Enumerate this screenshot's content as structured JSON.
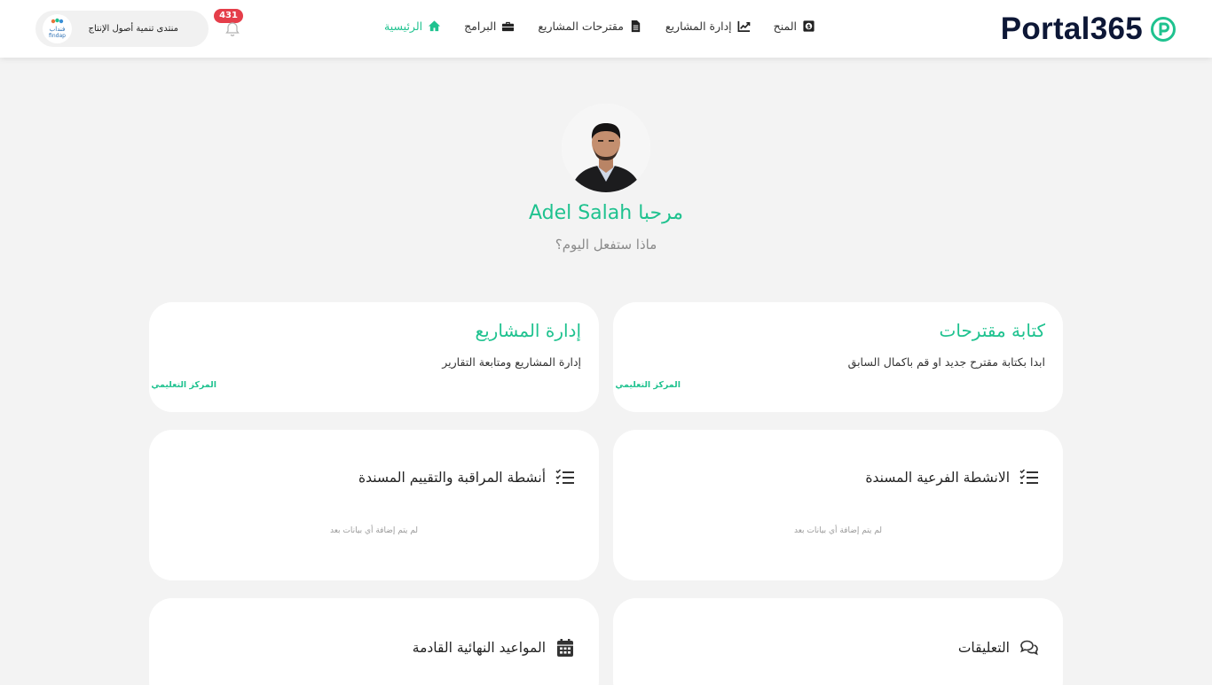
{
  "header": {
    "logo_text": "Portal365",
    "notifications_count": "431",
    "org_name": "منتدى تنمية أصول الإنتاج",
    "org_logo_text_ar": "فنداب",
    "org_logo_text_en": "findap"
  },
  "nav": [
    {
      "label": "الرئيسية",
      "icon": "home-icon",
      "active": true
    },
    {
      "label": "البرامج",
      "icon": "briefcase-icon",
      "active": false
    },
    {
      "label": "مقترحات المشاريع",
      "icon": "file-icon",
      "active": false
    },
    {
      "label": "إدارة المشاريع",
      "icon": "chart-line-icon",
      "active": false
    },
    {
      "label": "المنح",
      "icon": "money-bag-icon",
      "active": false
    }
  ],
  "profile": {
    "welcome": "مرحبا Adel Salah",
    "question": "ماذا ستفعل اليوم؟"
  },
  "cards": {
    "write_proposals": {
      "title": "كتابة مقترحات",
      "desc": "ابدا بكتابة مقترح جديد او قم باكمال السابق",
      "tag": "المركز التعليمي"
    },
    "manage_projects": {
      "title": "إدارة المشاريع",
      "desc": "إدارة المشاريع ومتابعة التقارير",
      "tag": "المركز التعليمي"
    },
    "sub_activities": {
      "title": "الانشطة الفرعية المسندة",
      "empty": "لم يتم إضافة أي بيانات بعد"
    },
    "monitoring": {
      "title": "أنشطة المراقبة والتقييم المسندة",
      "empty": "لم يتم إضافة أي بيانات بعد"
    },
    "comments": {
      "title": "التعليقات"
    },
    "deadlines": {
      "title": "المواعيد النهائية القادمة"
    }
  },
  "colors": {
    "accent": "#1fc28f",
    "brand_dark": "#0d1736",
    "badge": "#e53e4a",
    "background": "#f3f3f3"
  }
}
